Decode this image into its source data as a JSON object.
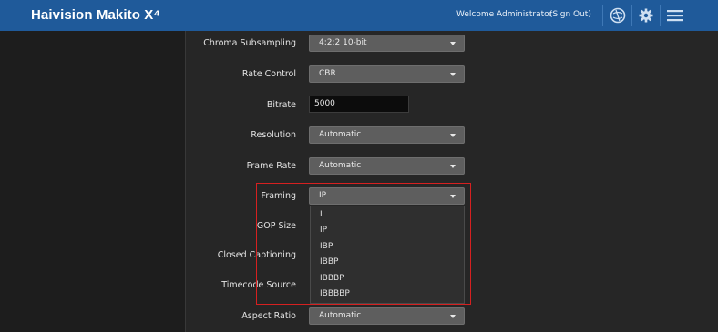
{
  "header": {
    "brand": "Haivision Makito X⁴",
    "welcome": "Welcome Administrator",
    "sign_out": "(Sign Out)",
    "icons": [
      "network-icon",
      "gear-icon",
      "menu-icon"
    ]
  },
  "form": {
    "chroma_subsampling": {
      "label": "Chroma Subsampling",
      "value": "4:2:2 10-bit"
    },
    "rate_control": {
      "label": "Rate Control",
      "value": "CBR"
    },
    "bitrate": {
      "label": "Bitrate",
      "value": "5000"
    },
    "resolution": {
      "label": "Resolution",
      "value": "Automatic"
    },
    "frame_rate": {
      "label": "Frame Rate",
      "value": "Automatic"
    },
    "framing": {
      "label": "Framing",
      "value": "IP",
      "options": [
        "I",
        "IP",
        "IBP",
        "IBBP",
        "IBBBP",
        "IBBBBP"
      ]
    },
    "gop_size": {
      "label": "GOP Size"
    },
    "closed_captioning": {
      "label": "Closed Captioning"
    },
    "timecode_source": {
      "label": "Timecode Source"
    },
    "aspect_ratio": {
      "label": "Aspect Ratio",
      "value": "Automatic"
    }
  },
  "colors": {
    "header": "#1f5a9a",
    "background": "#262626",
    "select": "#5e5e5e",
    "highlight": "#d62020"
  }
}
